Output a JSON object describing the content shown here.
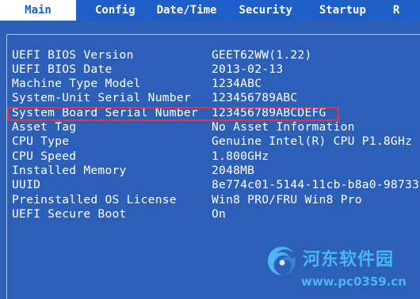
{
  "tabs": [
    {
      "label": "Main",
      "active": true
    },
    {
      "label": "Config",
      "active": false
    },
    {
      "label": "Date/Time",
      "active": false
    },
    {
      "label": "Security",
      "active": false
    },
    {
      "label": "Startup",
      "active": false
    },
    {
      "label": "R",
      "active": false
    }
  ],
  "info_rows": [
    {
      "label": "UEFI BIOS Version",
      "value": "GEET62WW(1.22)"
    },
    {
      "label": "UEFI BIOS Date",
      "value": "2013-02-13"
    },
    {
      "label": "Machine Type Model",
      "value": "1234ABC"
    },
    {
      "label": "System-Unit Serial Number",
      "value": "123456789ABC"
    },
    {
      "label": "System Board Serial Number",
      "value": "123456789ABCDEFG"
    },
    {
      "label": "Asset Tag",
      "value": "No Asset Information"
    },
    {
      "label": "CPU Type",
      "value": "Genuine Intel(R) CPU P1.8GHz"
    },
    {
      "label": "CPU Speed",
      "value": "1.800GHz"
    },
    {
      "label": "Installed Memory",
      "value": "2048MB"
    },
    {
      "label": "UUID",
      "value": "8e774c01-5144-11cb-b8a0-98733"
    },
    {
      "label": "Preinstalled OS License",
      "value": "Win8 PRO/FRU Win8 Pro"
    },
    {
      "label": "UEFI Secure Boot",
      "value": "On"
    }
  ],
  "highlighted_row": "System Board Serial Number",
  "watermark": {
    "title": "河东软件园",
    "url": "www.pc0359.cn",
    "icon": "swirl-logo-icon"
  },
  "colors": {
    "background": "#2b5fb8",
    "tab_bar": "#1d5ec9",
    "highlight_border": "#e8333a",
    "watermark": "#4bb6ef"
  }
}
